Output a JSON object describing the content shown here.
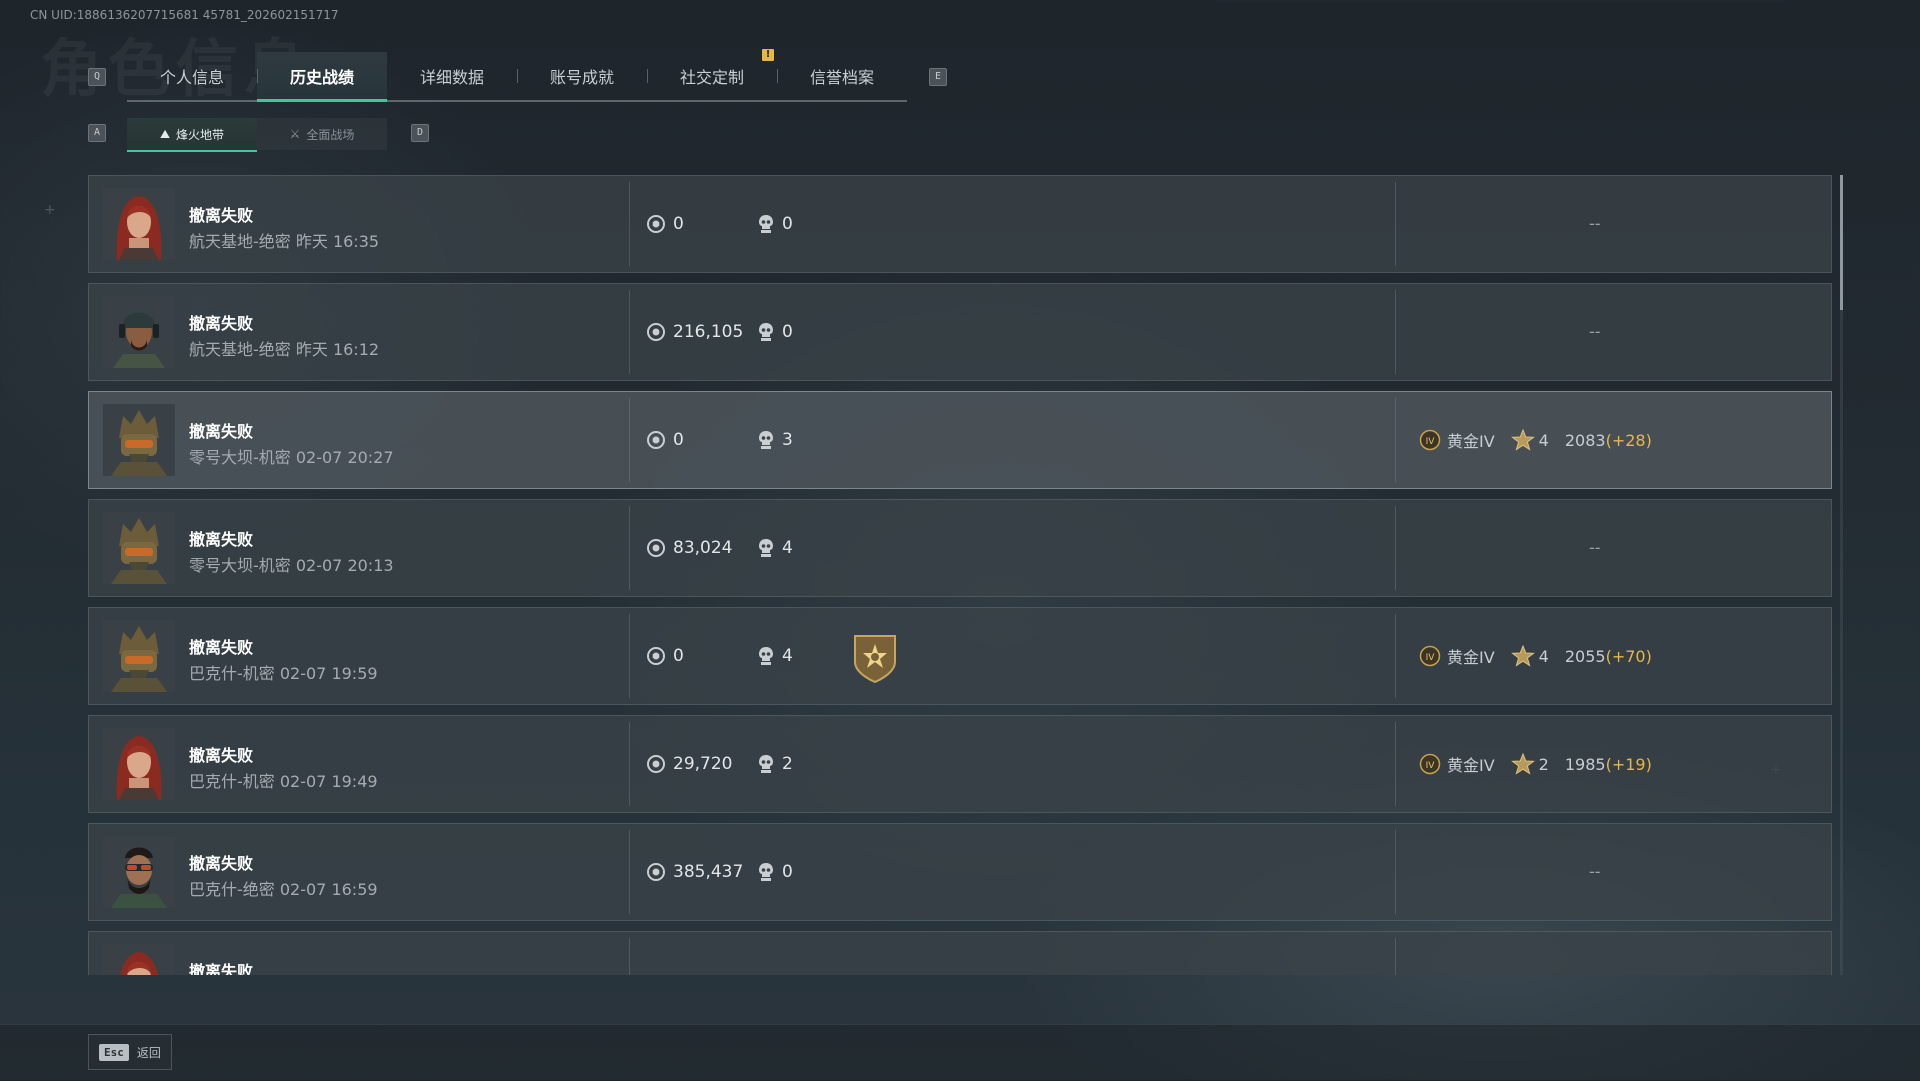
{
  "uid": "CN UID:1886136207715681 45781_202602151717",
  "background_title": "角色信息",
  "tabs_nav": {
    "prev_key": "Q",
    "next_key": "E",
    "alert_badge": "!"
  },
  "tabs": [
    {
      "label": "个人信息",
      "active": false
    },
    {
      "label": "历史战绩",
      "active": true
    },
    {
      "label": "详细数据",
      "active": false
    },
    {
      "label": "账号成就",
      "active": false
    },
    {
      "label": "社交定制",
      "active": false
    },
    {
      "label": "信誉档案",
      "active": false
    }
  ],
  "subtabs_nav": {
    "prev_key": "A",
    "next_key": "D"
  },
  "subtabs": [
    {
      "label": "烽火地带",
      "active": true
    },
    {
      "label": "全面战场",
      "active": false
    }
  ],
  "records": [
    {
      "avatar": "red-hair-woman",
      "status": "撤离失败",
      "detail": "航天基地-绝密 昨天 16:35",
      "value": "0",
      "kills": "0",
      "medal": false,
      "rank": null,
      "rank_text": "--"
    },
    {
      "avatar": "cap-headset-man",
      "status": "撤离失败",
      "detail": "航天基地-绝密 昨天 16:12",
      "value": "216,105",
      "kills": "0",
      "medal": false,
      "rank": null,
      "rank_text": "--"
    },
    {
      "avatar": "masked-helmet-soldier",
      "status": "撤离失败",
      "detail": "零号大坝-机密 02-07 20:27",
      "value": "0",
      "kills": "3",
      "medal": false,
      "rank": {
        "tier": "黄金IV",
        "stars": "4",
        "score": "2083",
        "delta": "(+28)"
      },
      "rank_text": ""
    },
    {
      "avatar": "masked-helmet-soldier",
      "status": "撤离失败",
      "detail": "零号大坝-机密 02-07 20:13",
      "value": "83,024",
      "kills": "4",
      "medal": false,
      "rank": null,
      "rank_text": "--"
    },
    {
      "avatar": "masked-helmet-soldier",
      "status": "撤离失败",
      "detail": "巴克什-机密 02-07 19:59",
      "value": "0",
      "kills": "4",
      "medal": true,
      "rank": {
        "tier": "黄金IV",
        "stars": "4",
        "score": "2055",
        "delta": "(+70)"
      },
      "rank_text": ""
    },
    {
      "avatar": "red-hair-woman",
      "status": "撤离失败",
      "detail": "巴克什-机密 02-07 19:49",
      "value": "29,720",
      "kills": "2",
      "medal": false,
      "rank": {
        "tier": "黄金IV",
        "stars": "2",
        "score": "1985",
        "delta": "(+19)"
      },
      "rank_text": ""
    },
    {
      "avatar": "bearded-goggles-man",
      "status": "撤离失败",
      "detail": "巴克什-绝密 02-07 16:59",
      "value": "385,437",
      "kills": "0",
      "medal": false,
      "rank": null,
      "rank_text": "--"
    },
    {
      "avatar": "red-hair-woman",
      "status": "撤离失败",
      "detail": "",
      "value": "",
      "kills": "",
      "medal": false,
      "rank": null,
      "rank_text": ""
    }
  ],
  "back_button": {
    "key": "Esc",
    "label": "返回"
  },
  "colors": {
    "accent": "#3fc89c",
    "rank_gold": "#e7b64d",
    "alert": "#e8b840"
  }
}
